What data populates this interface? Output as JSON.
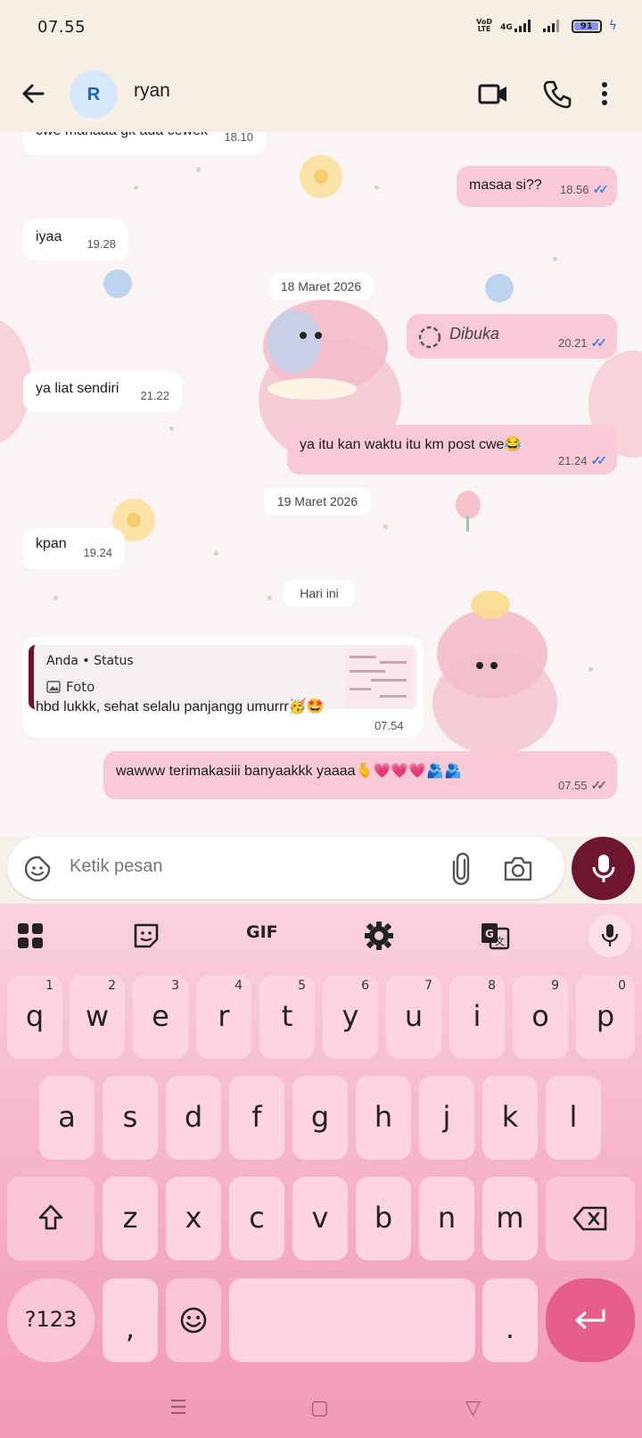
{
  "status_bar": {
    "time": "07.55",
    "network_label": "VoD LTE",
    "network_type": "4G",
    "battery": "91",
    "icons": [
      "signal-icon",
      "battery-icon",
      "charging-icon"
    ]
  },
  "header": {
    "avatar_initial": "R",
    "contact_name": "ryan",
    "icons": [
      "back-arrow-icon",
      "video-call-icon",
      "phone-icon",
      "more-options-icon"
    ]
  },
  "colors": {
    "header_bg": "#f7efe4",
    "incoming_bubble": "#ffffff",
    "outgoing_bubble": "#f8c9d7",
    "accent": "#6e1530",
    "read_ticks": "#3f7fe0",
    "keyboard_key": "#fdd4e0",
    "enter_key": "#e65f8b"
  },
  "messages": [
    {
      "dir": "in",
      "text": "cwe manaaa gk ada cewek",
      "time": "18.10"
    },
    {
      "dir": "out",
      "text": "masaa si??",
      "time": "18.56",
      "status": "read"
    },
    {
      "dir": "in",
      "text": "iyaa",
      "time": "19.28"
    },
    {
      "dir": "date",
      "text": "18 Maret 2026"
    },
    {
      "dir": "out",
      "text": "Dibuka",
      "time": "20.21",
      "status": "read",
      "type": "view-once"
    },
    {
      "dir": "in",
      "text": "ya liat sendiri",
      "time": "21.22"
    },
    {
      "dir": "out",
      "text": "ya itu kan waktu itu km post cwe😂",
      "time": "21.24",
      "status": "read"
    },
    {
      "dir": "date",
      "text": "19 Maret 2026"
    },
    {
      "dir": "in",
      "text": "kpan",
      "time": "19.24"
    },
    {
      "dir": "date",
      "text": "Hari ini"
    },
    {
      "dir": "in",
      "text": "hbd lukkk, sehat selalu panjangg umurrr🥳🤩",
      "time": "07.54",
      "reply": {
        "author": "Anda • Status",
        "type": "Foto"
      }
    },
    {
      "dir": "out",
      "text": "wawww terimakasiii banyaakkk yaaaa🫰💗💗💗🫂🫂",
      "time": "07.55",
      "status": "delivered"
    }
  ],
  "input": {
    "placeholder": "Ketik pesan",
    "icons": [
      "sticker-icon",
      "attach-icon",
      "camera-icon",
      "microphone-icon"
    ]
  },
  "keyboard": {
    "toolbar": {
      "gif_label": "GIF",
      "icons": [
        "apps-grid-icon",
        "sticker-icon",
        "settings-icon",
        "translate-icon",
        "microphone-icon"
      ]
    },
    "row1": [
      "q",
      "w",
      "e",
      "r",
      "t",
      "y",
      "u",
      "i",
      "o",
      "p"
    ],
    "row1_hints": [
      "1",
      "2",
      "3",
      "4",
      "5",
      "6",
      "7",
      "8",
      "9",
      "0"
    ],
    "row2": [
      "a",
      "s",
      "d",
      "f",
      "g",
      "h",
      "j",
      "k",
      "l"
    ],
    "row3": [
      "z",
      "x",
      "c",
      "v",
      "b",
      "n",
      "m"
    ],
    "symbols_label": "?123",
    "comma": ",",
    "period": ".",
    "icons": [
      "shift-icon",
      "backspace-icon",
      "emoji-icon",
      "enter-icon"
    ]
  },
  "nav_bar": {
    "icons": [
      "recent-apps-icon",
      "home-icon",
      "back-icon"
    ],
    "labels": [
      "☰",
      "▢",
      "▽"
    ]
  }
}
